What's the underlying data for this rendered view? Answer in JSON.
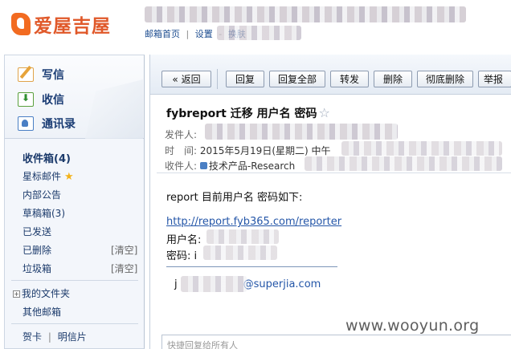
{
  "brand": {
    "name": "爱屋吉屋"
  },
  "header": {
    "links": [
      "邮箱首页",
      "|",
      "设置",
      "-",
      "换肤"
    ]
  },
  "sidebar": {
    "actions": [
      {
        "label": "写信",
        "icon": "compose-icon"
      },
      {
        "label": "收信",
        "icon": "inbox-download-icon"
      },
      {
        "label": "通讯录",
        "icon": "contacts-icon"
      }
    ],
    "folders": {
      "inbox": "收件箱(4)",
      "starred": "星标邮件",
      "notice": "内部公告",
      "drafts": "草稿箱(3)",
      "sent": "已发送",
      "deleted": "已删除",
      "spam": "垃圾箱",
      "clear": "[清空]",
      "my_folders": "我的文件夹",
      "other": "其他邮箱",
      "card": "贺卡",
      "sep": "|",
      "postcard": "明信片"
    }
  },
  "toolbar": {
    "back": "«  返回",
    "reply": "回复",
    "reply_all": "回复全部",
    "forward": "转发",
    "delete": "删除",
    "delete_forever": "彻底删除",
    "report": "举报"
  },
  "email": {
    "subject": "fybreport 迁移 用户名 密码",
    "from_label": "发件人:",
    "time_label": "时　间:",
    "time_value": "2015年5月19日(星期二) 中午",
    "to_label": "收件人:",
    "to_value": "技术产品-Research",
    "body_intro": "report 目前用户名 密码如下:",
    "url": "http://report.fyb365.com/reporter",
    "username_label": "用户名:",
    "password_label": "密码: i",
    "signature_email_prefix": "j",
    "signature_email_suffix": "@superjia.com"
  },
  "reply_box": {
    "placeholder": "快捷回复给所有人"
  },
  "watermark": "www.wooyun.org",
  "colors": {
    "brand": "#e0592a",
    "link": "#2456a8",
    "sidebar_bg": "#f3f6fb"
  }
}
